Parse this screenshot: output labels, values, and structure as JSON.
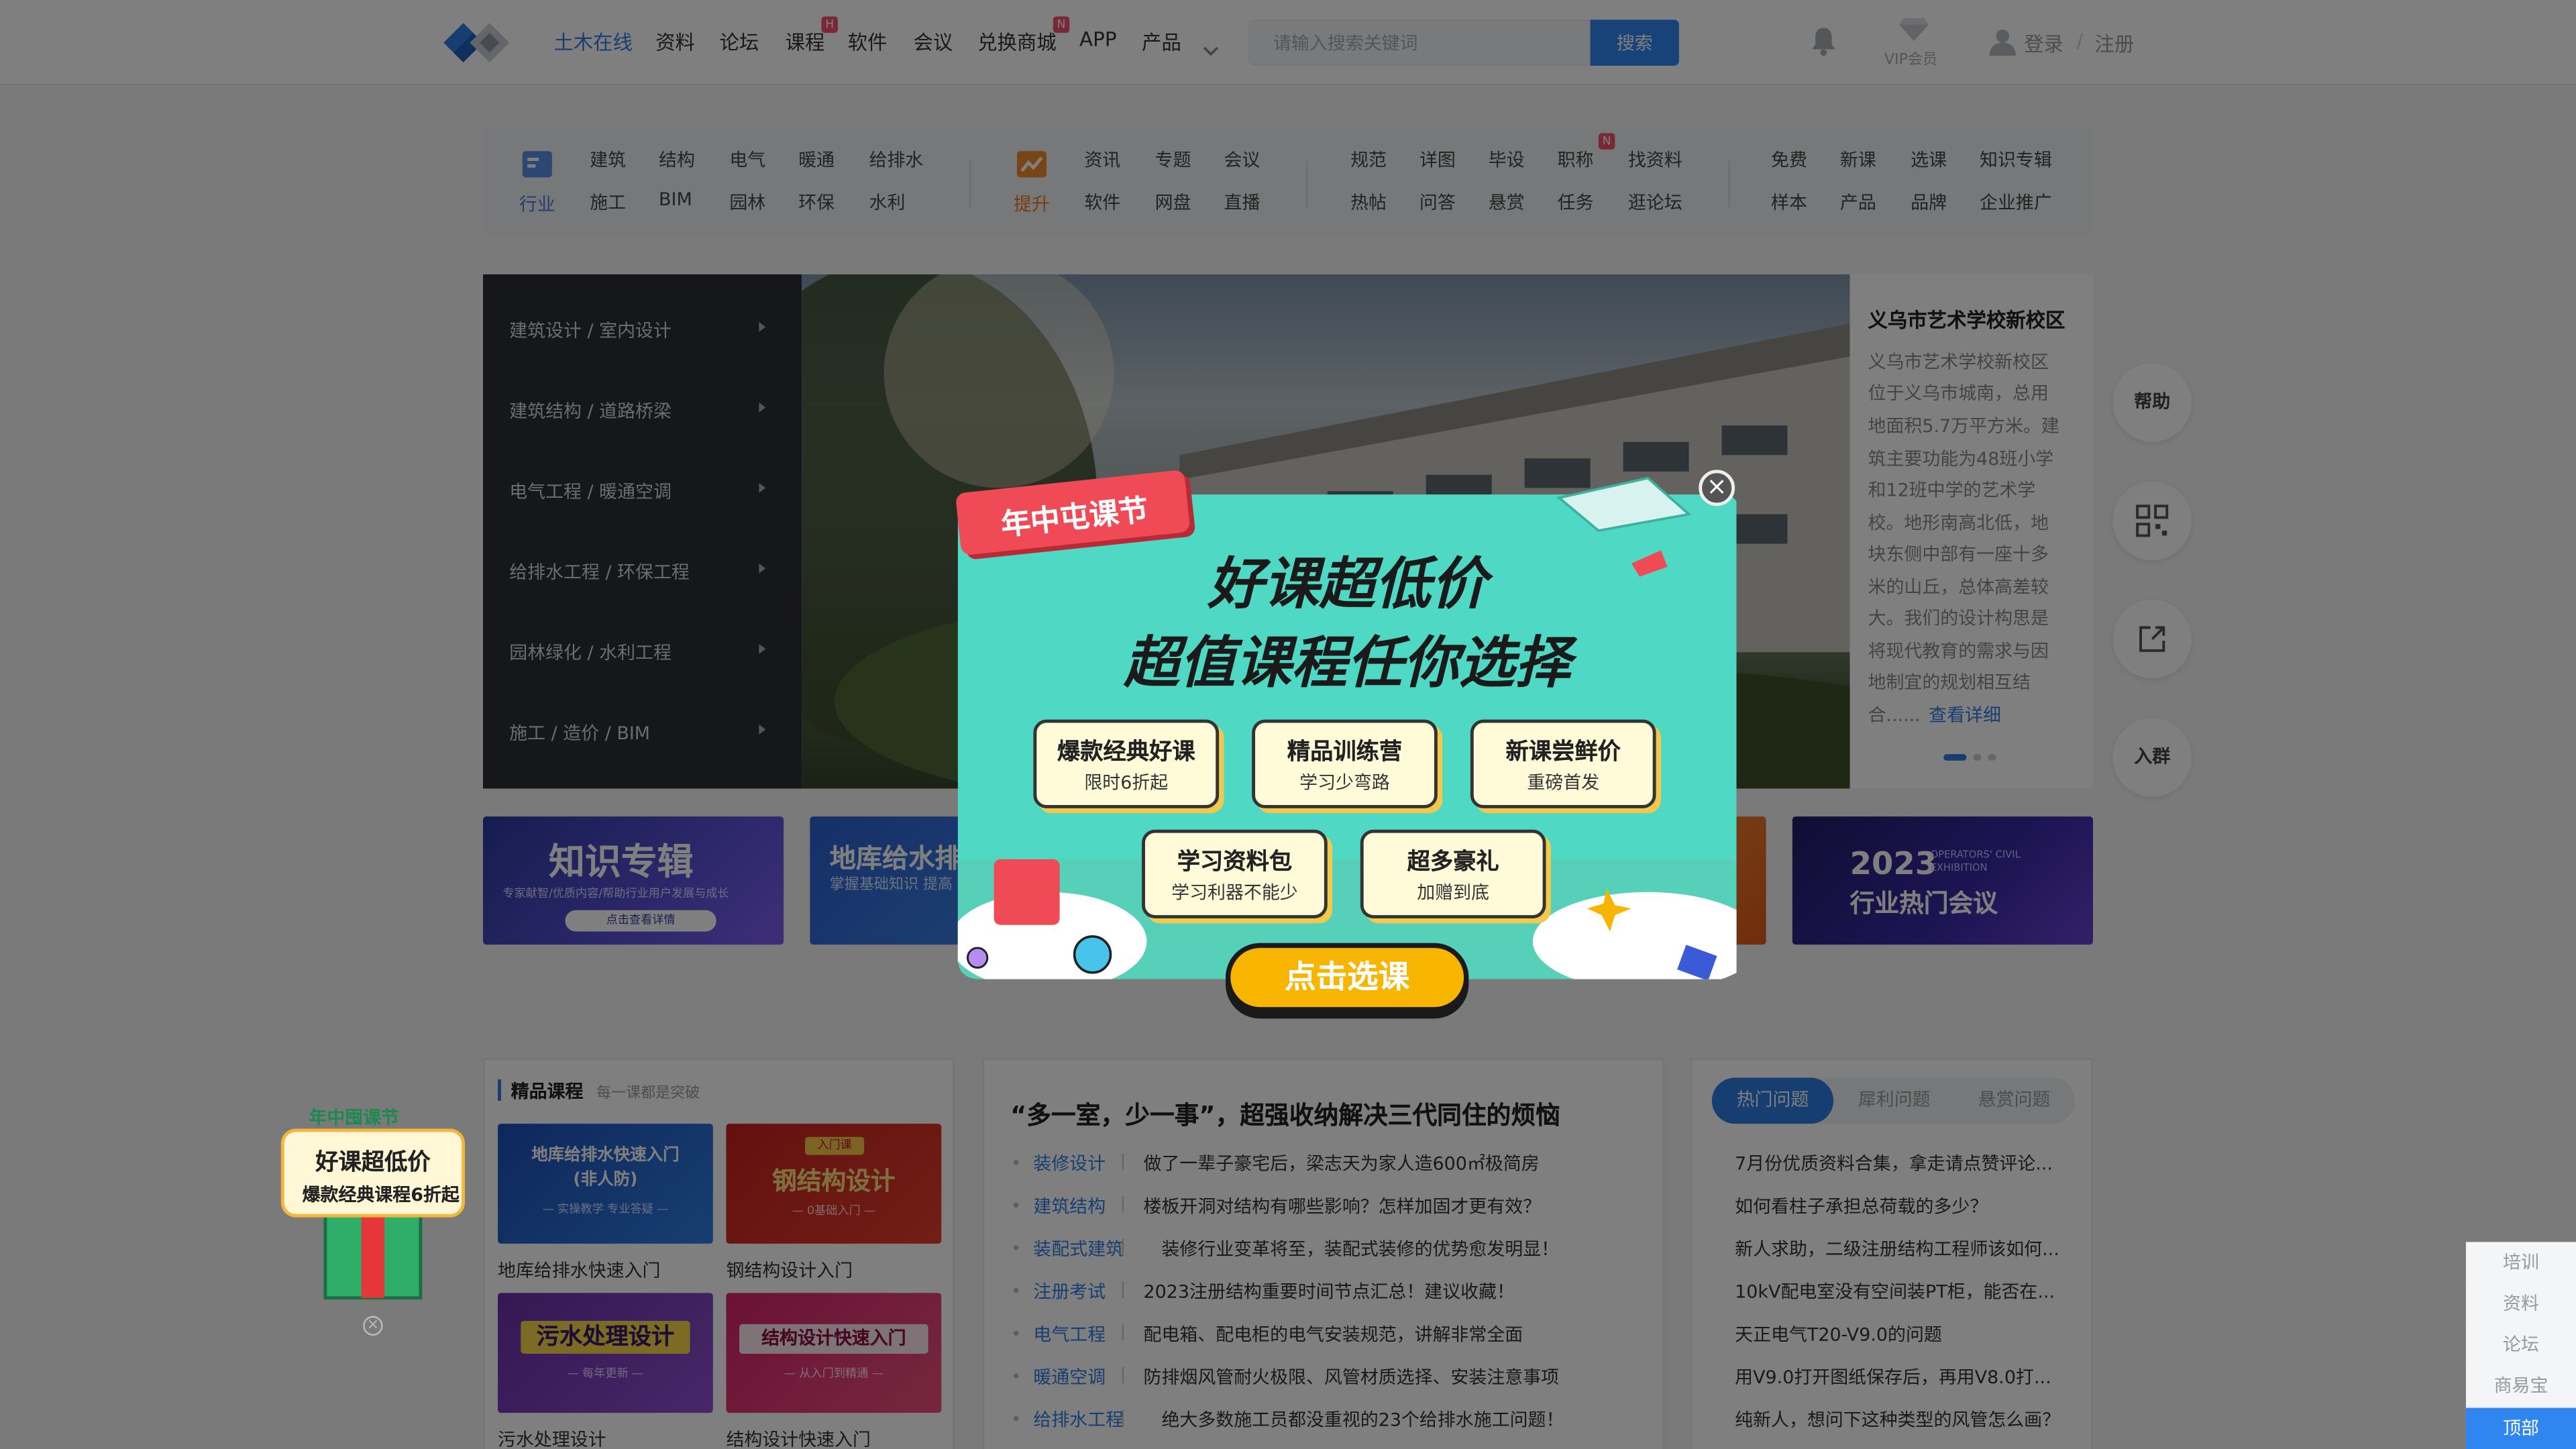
{
  "header": {
    "nav": [
      {
        "label": "土木在线",
        "active": true
      },
      {
        "label": "资料"
      },
      {
        "label": "论坛"
      },
      {
        "label": "课程",
        "badge": "H"
      },
      {
        "label": "软件"
      },
      {
        "label": "会议"
      },
      {
        "label": "兑换商城",
        "badge": "N"
      },
      {
        "label": "APP"
      },
      {
        "label": "产品"
      }
    ],
    "search_placeholder": "请输入搜索关键词",
    "search_button": "搜索",
    "vip_label": "VIP会员",
    "login": "登录",
    "separator": "/",
    "register": "注册"
  },
  "categories": {
    "industry_label": "行业",
    "industry_row1": [
      "建筑",
      "结构",
      "电气",
      "暖通",
      "给排水"
    ],
    "industry_row2": [
      "施工",
      "BIM",
      "园林",
      "环保",
      "水利"
    ],
    "improve_label": "提升",
    "improve_row1": [
      "资讯",
      "专题",
      "会议"
    ],
    "improve_row2": [
      "软件",
      "网盘",
      "直播"
    ],
    "group3_row1": [
      "规范",
      "详图",
      "毕设",
      "职称",
      "找资料"
    ],
    "group3_row2": [
      "热帖",
      "问答",
      "悬赏",
      "任务",
      "逛论坛"
    ],
    "group3_badge": "N",
    "group4_row1": [
      "免费",
      "新课",
      "选课",
      "知识专辑"
    ],
    "group4_row2": [
      "样本",
      "产品",
      "品牌",
      "企业推广"
    ]
  },
  "left_menu": [
    "建筑设计 / 室内设计",
    "建筑结构 / 道路桥梁",
    "电气工程 / 暖通空调",
    "给排水工程 / 环保工程",
    "园林绿化 / 水利工程",
    "施工 / 造价 / BIM"
  ],
  "feature": {
    "title": "义乌市艺术学校新校区",
    "body_lines": [
      "义乌市艺术学校新校区",
      "位于义乌市城南，总用",
      "地面积5.7万平方米。建",
      "筑主要功能为48班小学",
      "和12班中学的艺术学",
      "校。地形南高北低，地",
      "块东侧中部有一座十多",
      "米的山丘，总体高差较",
      "大。我们的设计构思是",
      "将现代教育的需求与因",
      "地制宜的规划相互结",
      "合......"
    ],
    "more": "查看详细"
  },
  "promos": {
    "p1_title": "知识专辑",
    "p1_sub": "专家献智/优质内容/帮助行业用户发展与成长",
    "p1_btn": "点击查看详情",
    "p2_title": "地库给水排",
    "p2_sub": "掌握基础知识  提高",
    "p5_year": "2023",
    "p5_tag": "OPERATORS' CIVIL EXHIBITION",
    "p5_title": "行业热门会议"
  },
  "right_float": [
    "帮助",
    "",
    "",
    "入群"
  ],
  "courses": {
    "title": "精品课程",
    "subtitle": "每一课都是突破",
    "items": [
      {
        "img_title": "地库给排水快速入门",
        "img_title2": "(非人防)",
        "img_sub": "— 实操教学 专业答疑 —",
        "caption": "地库给排水快速入门"
      },
      {
        "img_badge": "入门课",
        "img_title": "钢结构设计",
        "img_sub": "— 0基础入门 —",
        "caption": "钢结构设计入门"
      },
      {
        "img_title": "污水处理设计",
        "img_sub": "— 每年更新 —",
        "caption": "污水处理设计"
      },
      {
        "img_title": "结构设计快速入门",
        "img_sub": "— 从入门到精通 —",
        "caption": "结构设计快速入门"
      }
    ]
  },
  "articles": {
    "headline": "“多一室，少一事”，超强收纳解决三代同住的烦恼",
    "items": [
      {
        "cat": "装修设计",
        "title": "做了一辈子豪宅后，梁志天为家人造600㎡极简房"
      },
      {
        "cat": "建筑结构",
        "title": "楼板开洞对结构有哪些影响？怎样加固才更有效？"
      },
      {
        "cat": "装配式建筑",
        "title": "装修行业变革将至，装配式装修的优势愈发明显！"
      },
      {
        "cat": "注册考试",
        "title": "2023注册结构重要时间节点汇总！建议收藏！"
      },
      {
        "cat": "电气工程",
        "title": "配电箱、配电柜的电气安装规范，讲解非常全面"
      },
      {
        "cat": "暖通空调",
        "title": "防排烟风管耐火极限、风管材质选择、安装注意事项"
      },
      {
        "cat": "给排水工程",
        "title": "绝大多数施工员都没重视的23个给排水施工问题！"
      }
    ]
  },
  "questions": {
    "tabs": [
      "热门问题",
      "犀利问题",
      "悬赏问题"
    ],
    "items": [
      "7月份优质资料合集，拿走请点赞评论...",
      "如何看柱子承担总荷载的多少？",
      "新人求助，二级注册结构工程师该如何...",
      "10kV配电室没有空间装PT柜，能否在...",
      "天正电气T20-V9.0的问题",
      "用V9.0打开图纸保存后，再用V8.0打...",
      "纯新人，想问下这种类型的风管怎么画？"
    ]
  },
  "side_ad": {
    "l1": "年中囤课节",
    "l2": "好课超低价",
    "l3": "爆款经典课程6折起"
  },
  "side_nav": [
    "培训",
    "资料",
    "论坛",
    "商易宝",
    "顶部"
  ],
  "modal": {
    "tag": "年中屯课节",
    "title1": "好课超低价",
    "title2": "超值课程任你选择",
    "buttons": [
      {
        "a": "爆款经典好课",
        "b": "限时6折起"
      },
      {
        "a": "精品训练营",
        "b": "学习少弯路"
      },
      {
        "a": "新课尝鲜价",
        "b": "重磅首发"
      },
      {
        "a": "学习资料包",
        "b": "学习利器不能少"
      },
      {
        "a": "超多豪礼",
        "b": "加赠到底"
      }
    ],
    "cta": "点击选课",
    "close": "×"
  },
  "colors": {
    "primary": "#2f86f0",
    "accent": "#f7b500",
    "modal_bg": "#4fd8c4",
    "tag_red": "#ef4a55"
  }
}
